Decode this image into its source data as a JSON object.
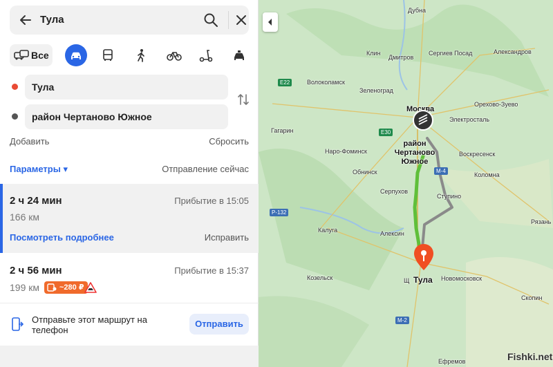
{
  "search": {
    "query": "Тула"
  },
  "modes": {
    "all_label": "Все"
  },
  "waypoints": {
    "from": "Тула",
    "to": "район Чертаново Южное"
  },
  "actions": {
    "add": "Добавить",
    "reset": "Сбросить"
  },
  "params": {
    "label": "Параметры ▾",
    "departure": "Отправление сейчас"
  },
  "routes": [
    {
      "time": "2 ч 24 мин",
      "arrival": "Прибытие в 15:05",
      "distance": "166 км",
      "details": "Посмотреть подробнее",
      "fix": "Исправить"
    },
    {
      "time": "2 ч 56 мин",
      "arrival": "Прибытие в 15:37",
      "distance": "199 км",
      "toll": "~280 ₽"
    }
  ],
  "send": {
    "text": "Отправьте этот маршрут на телефон",
    "button": "Отправить"
  },
  "map": {
    "labels": {
      "dubna": "Дубна",
      "klin": "Клин",
      "dmitrov": "Дмитров",
      "sergiev": "Сергиев Посад",
      "alexandrov": "Александров",
      "volokolamsk": "Волоколамск",
      "zelenograd": "Зеленоград",
      "moskva": "Москва",
      "orekhovo": "Орехово-Зуево",
      "gagarin": "Гагарин",
      "elektrostal": "Электросталь",
      "chertanovo": "район Чертаново Южное",
      "naro": "Наро-Фоминск",
      "voskresensk": "Воскресенск",
      "obninsk": "Обнинск",
      "kolomna": "Коломна",
      "serpukhov": "Серпухов",
      "stupino": "Ступино",
      "kaluga": "Калуга",
      "aleksin": "Алексин",
      "ryazan": "Рязань",
      "kozelsk": "Козельск",
      "shch": "Щ",
      "tula": "Тула",
      "novomoskovsk": "Новомосковск",
      "skopin": "Скопин",
      "efremov": "Ефремов"
    },
    "shields": {
      "e22": "E22",
      "e30": "E30",
      "m4": "M-4",
      "p132": "P-132",
      "m2": "M-2"
    },
    "watermark": "Fishki.net"
  },
  "colors": {
    "accent": "#2a66e5",
    "toll": "#f06a2b",
    "route_main": "#5fbf3a",
    "route_alt": "#8a8a8a",
    "pin": "#f04e23"
  }
}
